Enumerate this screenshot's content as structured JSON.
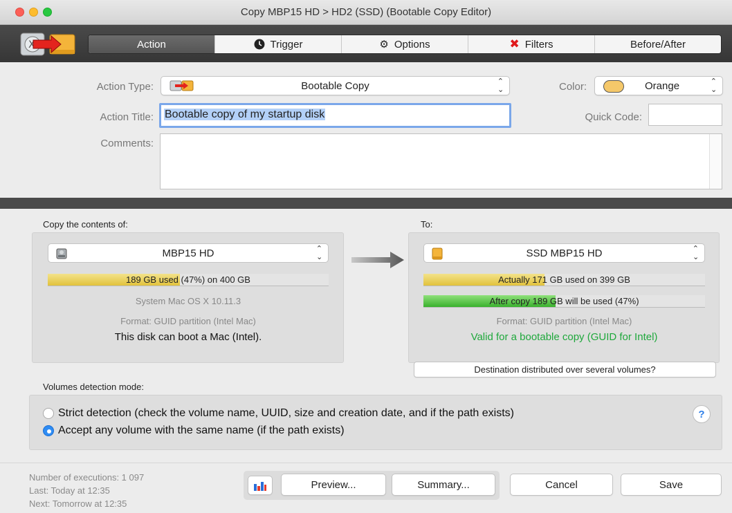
{
  "window": {
    "title": "Copy MBP15 HD > HD2 (SSD) (Bootable Copy Editor)"
  },
  "tabs": [
    {
      "label": "Action",
      "icon": "",
      "active": true
    },
    {
      "label": "Trigger",
      "icon": "clock-icon",
      "active": false
    },
    {
      "label": "Options",
      "icon": "gear-icon",
      "active": false
    },
    {
      "label": "Filters",
      "icon": "red-x-icon",
      "active": false
    },
    {
      "label": "Before/After",
      "icon": "",
      "active": false
    }
  ],
  "form": {
    "action_type_label": "Action Type:",
    "action_type_value": "Bootable Copy",
    "color_label": "Color:",
    "color_value": "Orange",
    "color_swatch": "#f5c86a",
    "action_title_label": "Action Title:",
    "action_title_value": "Bootable copy of my startup disk",
    "quick_code_label": "Quick Code:",
    "quick_code_value": "",
    "comments_label": "Comments:",
    "comments_value": ""
  },
  "source": {
    "section_label": "Copy the contents of:",
    "disk_name": "MBP15 HD",
    "usage_used": "189 GB used",
    "usage_rest": " (47%) on 400 GB",
    "usage_fraction": 0.47,
    "system": "System Mac OS X 10.11.3",
    "format": "Format: GUID partition (Intel Mac)",
    "boot_status": "This disk can boot a Mac (Intel)."
  },
  "destination": {
    "section_label": "To:",
    "disk_name": "SSD MBP15 HD",
    "actual_label": "Actually 171",
    "actual_rest": " GB used on 399 GB",
    "actual_fraction": 0.43,
    "after_label": "After copy 189",
    "after_rest": " GB will be used (47%)",
    "after_fraction": 0.47,
    "format": "Format: GUID partition (Intel Mac)",
    "valid_status": "Valid for a bootable copy (GUID for Intel)",
    "distributed_button": "Destination distributed over several volumes?"
  },
  "detection": {
    "section_label": "Volumes detection mode:",
    "options": [
      {
        "label": "Strict detection (check the volume name, UUID, size and creation date, and if the path exists)",
        "selected": false
      },
      {
        "label": "Accept any volume with the same name (if the path exists)",
        "selected": true
      }
    ],
    "help_label": "?"
  },
  "footer": {
    "executions": "Number of executions: 1 097",
    "last": "Last: Today at 12:35",
    "next": "Next: Tomorrow at 12:35",
    "preview_button": "Preview...",
    "summary_button": "Summary...",
    "cancel_button": "Cancel",
    "save_button": "Save"
  }
}
